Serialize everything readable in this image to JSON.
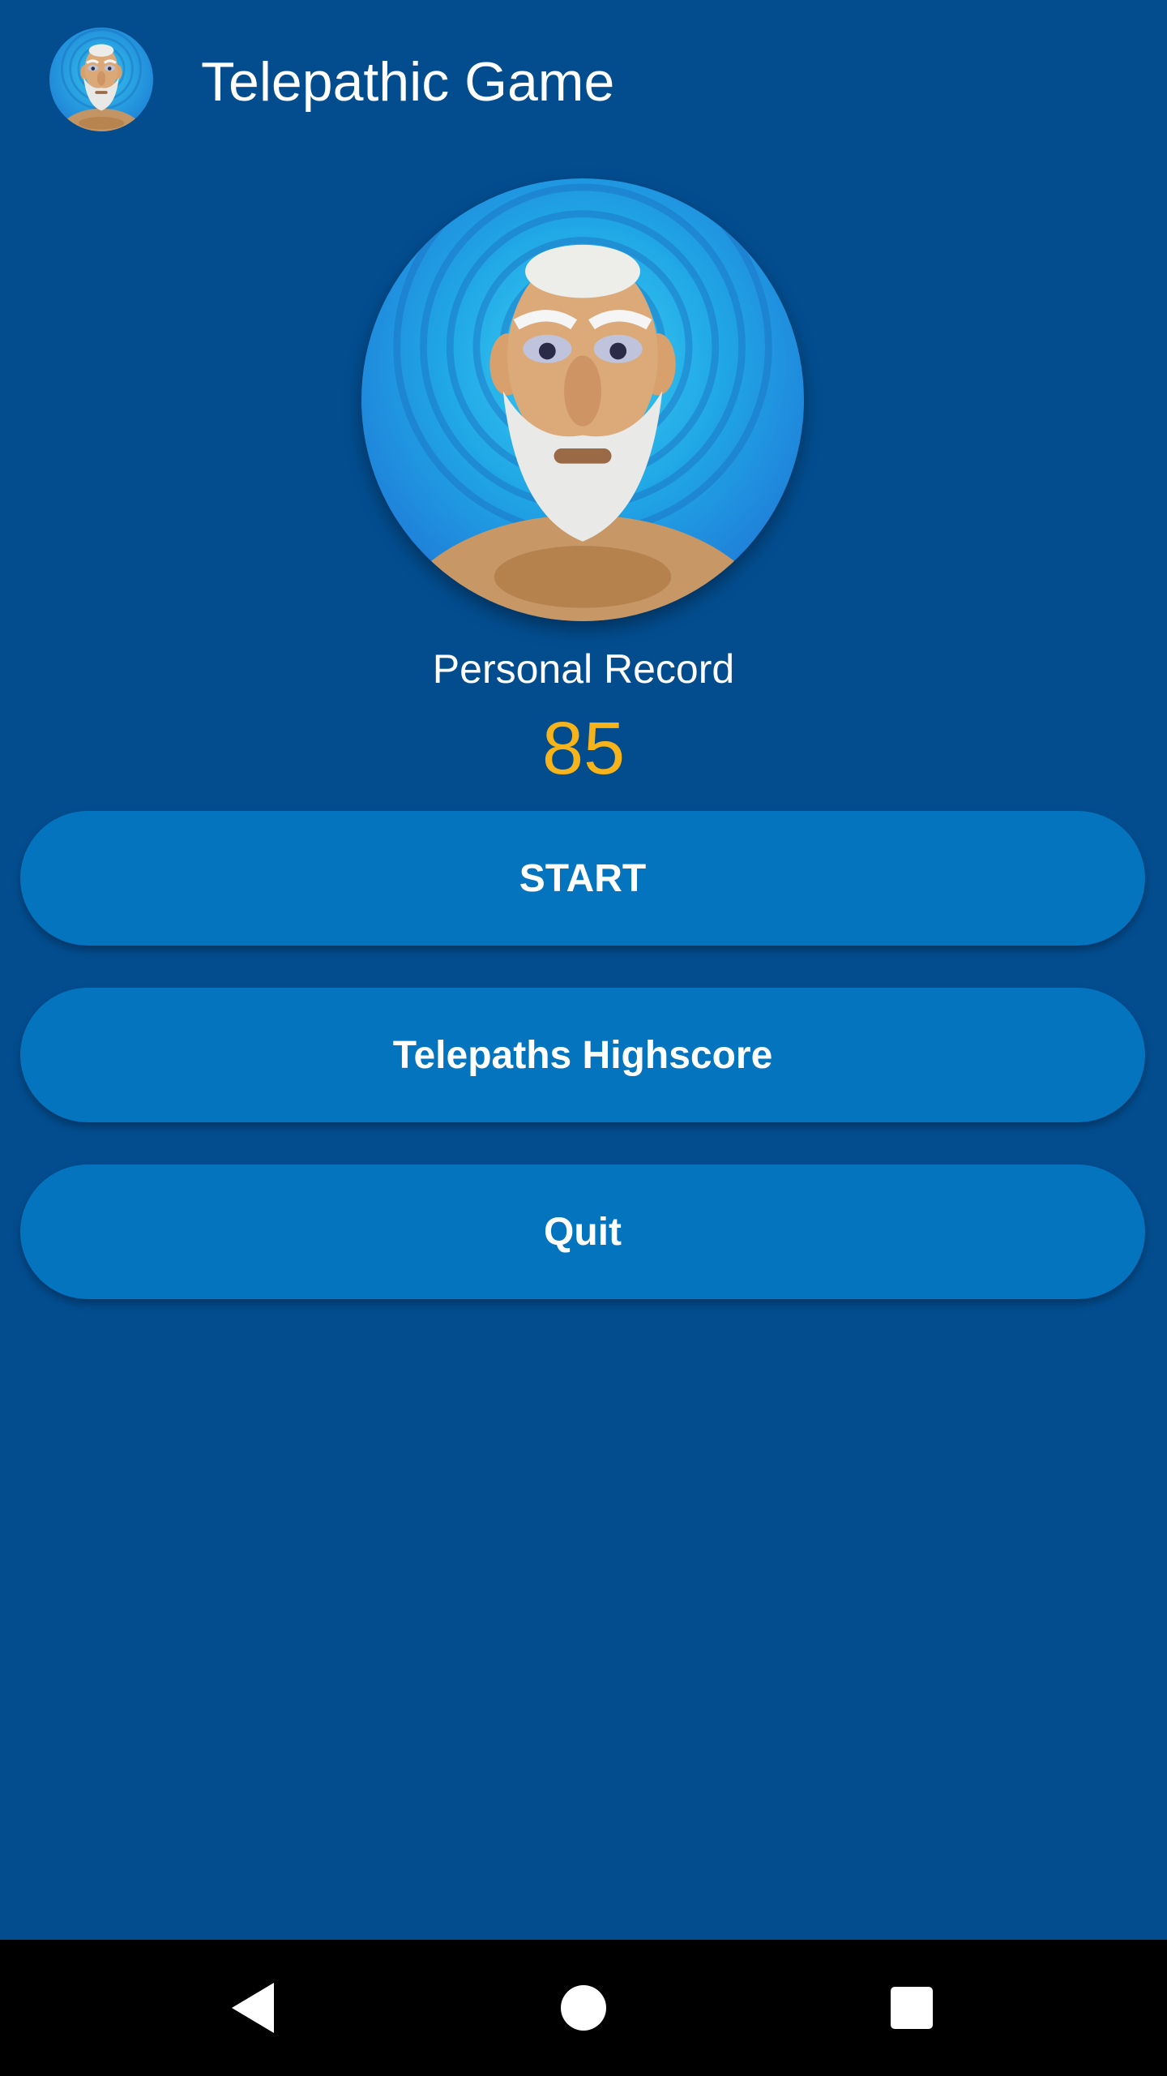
{
  "app_bar": {
    "title": "Telepathic Game",
    "icon": "telepath-avatar-icon"
  },
  "hero": {
    "icon": "telepath-avatar-icon"
  },
  "record": {
    "label": "Personal Record",
    "value": "85"
  },
  "buttons": {
    "start": "START",
    "highscore": "Telepaths Highscore",
    "quit": "Quit"
  },
  "nav": {
    "back_icon": "back-triangle-icon",
    "home_icon": "home-circle-icon",
    "recents_icon": "recents-square-icon"
  },
  "colors": {
    "background": "#034d8f",
    "button": "#0474be",
    "record_value": "#f6b31a",
    "nav_bar": "#000000"
  }
}
